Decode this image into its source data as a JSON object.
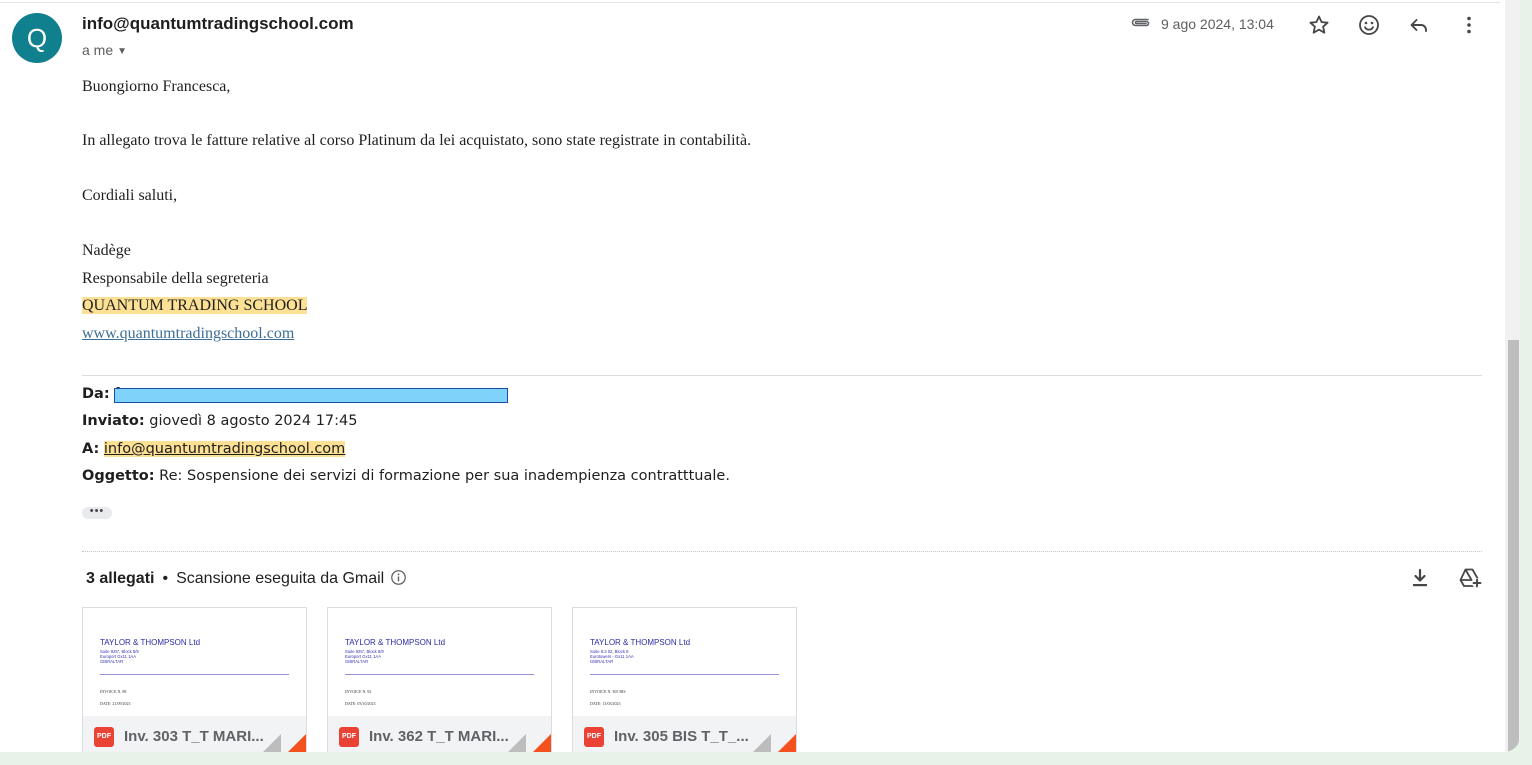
{
  "colors": {
    "avatar": "#10808f",
    "highlight": "#fce094",
    "link": "#3d6e95",
    "pdf": "#ea4335",
    "redaction": "#7fd3fb"
  },
  "header": {
    "avatar_letter": "Q",
    "sender": "info@quantumtradingschool.com",
    "recipient": "a me",
    "date": "9 ago 2024, 13:04",
    "icons": [
      "attachment-icon",
      "star-icon",
      "emoji-icon",
      "reply-icon",
      "more-vert-icon"
    ]
  },
  "body": {
    "greeting": "Buongiorno Francesca,",
    "paragraph": "In allegato trova le fatture relative al corso Platinum da lei acquistato, sono state registrate in contabilità.",
    "closing": "Cordiali saluti,",
    "signature_name": "Nadège",
    "signature_role": "Responsabile della segreteria",
    "signature_company": "QUANTUM TRADING SCHOOL",
    "signature_site": "www.quantumtradingschool.com"
  },
  "quoted": {
    "from_label": "Da:",
    "from_visible": "f",
    "sent_label": "Inviato:",
    "sent_value": "giovedì 8 agosto 2024 17:45",
    "to_label": "A:",
    "to_value": "info@quantumtradingschool.com",
    "subject_label": "Oggetto:",
    "subject_value": "Re: Sospensione dei servizi di formazione per sua inadempienza contratttuale.",
    "show_more": "•••"
  },
  "attachments": {
    "count_label": "3 allegati",
    "separator": "•",
    "scan_label": "Scansione eseguita da Gmail",
    "items": [
      {
        "name": "Inv. 303 T_T MARI...",
        "company": "TAYLOR & THOMPSON Ltd",
        "addr1": "Suite 925\", Block 8/9",
        "addr2": "Europort Gx11 1AA",
        "addr3": "GIBRALTAR",
        "invoice": "INVOICE N. 88",
        "doc_date": "DATE: 21/09/2023",
        "badge": "PDF"
      },
      {
        "name": "Inv. 362 T_T MARI...",
        "company": "TAYLOR & THOMPSON Ltd",
        "addr1": "Suite 925\", Block 8/9",
        "addr2": "Europort Gx11 1AA",
        "addr3": "GIBRALTAR",
        "invoice": "INVOICE N. 82",
        "doc_date": "DATE: 03/10/2023",
        "badge": "PDF"
      },
      {
        "name": "Inv. 305 BIS T_T_...",
        "company": "TAYLOR & THOMPSON Ltd",
        "addr1": "Suite 8.3 02, Block 8",
        "addr2": "Eurotowers - Gx11 1AA",
        "addr3": "GIBRALTAR",
        "invoice": "INVOICE N. 305 BIS",
        "doc_date": "DATE: 13/03/2023",
        "badge": "PDF"
      }
    ]
  }
}
